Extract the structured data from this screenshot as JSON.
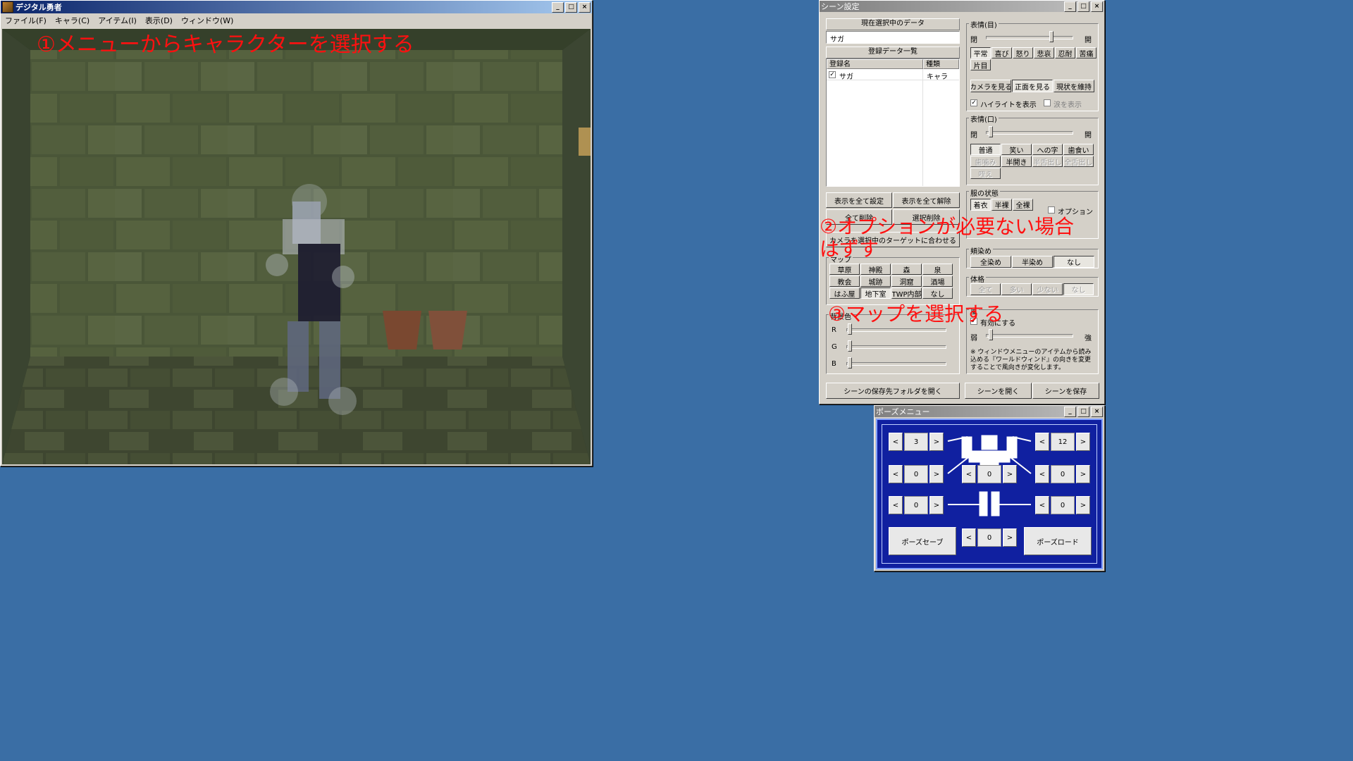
{
  "main_window": {
    "title": "デジタル勇者",
    "menu": [
      "ファイル(F)",
      "キャラ(C)",
      "アイテム(I)",
      "表示(D)",
      "ウィンドウ(W)"
    ]
  },
  "annotations": {
    "a1": "①メニューからキャラクターを選択する",
    "a2_line1": "②オプションが必要ない場合",
    "a2_line2": "はずす",
    "a3": "③マップを選択する"
  },
  "scene": {
    "title": "シーン設定",
    "current_header": "現在選択中のデータ",
    "current_value": "サガ",
    "registered_header": "登録データ一覧",
    "col_name": "登録名",
    "col_type": "種類",
    "rows": [
      {
        "name": "サガ",
        "type": "キャラ",
        "checked": true
      }
    ],
    "btn_show_all": "表示を全て設定",
    "btn_hide_all": "表示を全て解除",
    "btn_delete_all": "全て削除",
    "btn_delete_selected": "選択削除",
    "btn_camera_target": "カメラを選択中のターゲットに合わせる",
    "map_group": "マップ",
    "maps": [
      "草原",
      "神殿",
      "森",
      "泉",
      "教会",
      "城跡",
      "洞窟",
      "酒場",
      "はふ屋",
      "地下室",
      "TWP内部",
      "なし"
    ],
    "bg_group": "背景色",
    "bg_r": "R",
    "bg_g": "G",
    "bg_b": "B",
    "eye_group": "表情(目)",
    "eye_left": "閉",
    "eye_right": "開",
    "eye_buttons": [
      "平常",
      "喜び",
      "怒り",
      "悲哀",
      "忍耐",
      "苦痛",
      "片目"
    ],
    "look_camera": "カメラを見る",
    "look_front": "正面を見る",
    "look_keep": "現状を維持",
    "highlight": "ハイライトを表示",
    "tears": "涙を表示",
    "mouth_group": "表情(口)",
    "mouth_left": "閉",
    "mouth_right": "開",
    "mouth_buttons": [
      "普通",
      "笑い",
      "への字",
      "歯食い",
      "歯噛み",
      "半開き",
      "半舌出し",
      "全舌出し",
      "咥え"
    ],
    "clothes_group": "服の状態",
    "clothes_buttons": [
      "着衣",
      "半裸",
      "全裸"
    ],
    "option": "オプション",
    "blush_group": "頬染め",
    "blush_buttons": [
      "全染め",
      "半染め",
      "なし"
    ],
    "sweat_group": "体格",
    "sweat_buttons": [
      "全て",
      "多い",
      "少ない",
      "なし"
    ],
    "wind_group": "風",
    "wind_enable": "有効にする",
    "wind_left": "弱",
    "wind_right": "強",
    "wind_note": "※ ウィンドウメニューのアイテムから読み込める『ワールドウィンド』の向きを変更することで風向きが変化します。",
    "btn_open_folder": "シーンの保存先フォルダを開く",
    "btn_open_scene": "シーンを開く",
    "btn_save_scene": "シーンを保存"
  },
  "pose": {
    "title": "ポーズメニュー",
    "left_values": [
      "3",
      "0",
      "0"
    ],
    "right_values": [
      "12",
      "0",
      "0"
    ],
    "center_value": "0",
    "bottom_value": "0",
    "prev": "<",
    "next": ">",
    "save": "ポーズセーブ",
    "load": "ポーズロード"
  },
  "colors": {
    "desktop": "#3a6ea5",
    "annotation": "#ff1010",
    "pose_bg": "#1020a0"
  }
}
